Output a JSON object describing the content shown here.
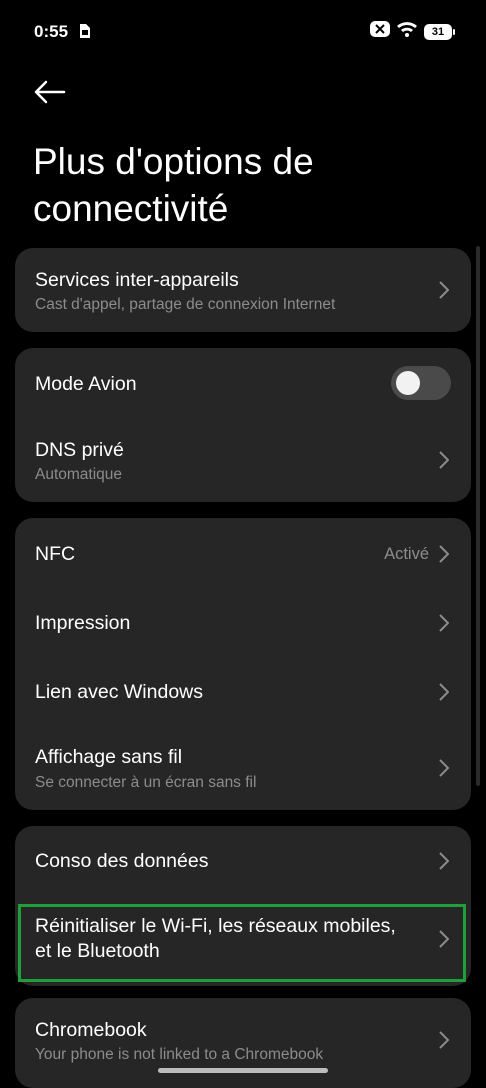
{
  "status_bar": {
    "time": "0:55",
    "battery": "31",
    "icons": [
      "sim-icon",
      "notification-off-icon",
      "wifi-icon",
      "battery-icon"
    ]
  },
  "header": {
    "title": "Plus d'options de connectivité"
  },
  "groups": [
    {
      "items": [
        {
          "label": "Services inter-appareils",
          "subtitle": "Cast d'appel, partage de connexion Internet"
        }
      ]
    },
    {
      "items": [
        {
          "label": "Mode Avion",
          "toggle": false
        },
        {
          "label": "DNS privé",
          "subtitle": "Automatique"
        }
      ]
    },
    {
      "items": [
        {
          "label": "NFC",
          "value": "Activé"
        },
        {
          "label": "Impression"
        },
        {
          "label": "Lien avec Windows"
        },
        {
          "label": "Affichage sans fil",
          "subtitle": "Se connecter à un écran sans fil"
        }
      ]
    },
    {
      "items": [
        {
          "label": "Conso des données"
        },
        {
          "label_line1": "Réinitialiser le Wi-Fi, les réseaux mobiles,",
          "label_line2": "et le Bluetooth",
          "highlighted": true
        }
      ]
    },
    {
      "items": [
        {
          "label": "Chromebook",
          "subtitle": "Your phone is not linked to a Chromebook"
        }
      ]
    }
  ],
  "colors": {
    "background": "#000000",
    "card": "#262626",
    "secondary_text": "#8c8c8c",
    "highlight": "#1f9e3a"
  }
}
